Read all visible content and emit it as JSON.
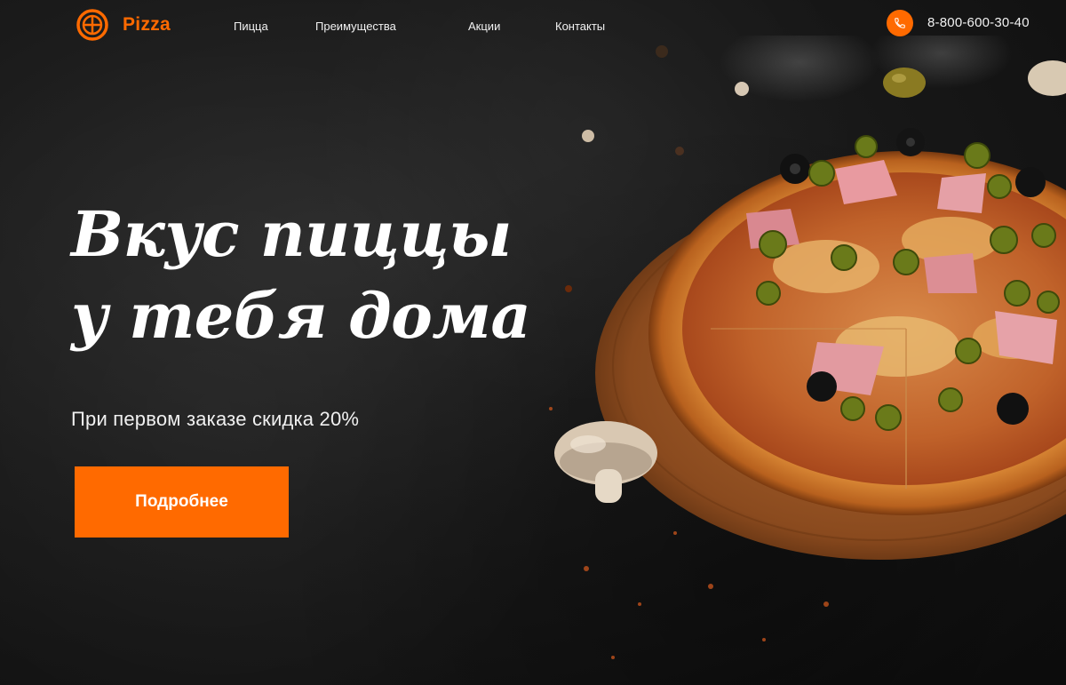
{
  "brand": {
    "name": "Pizza",
    "accent_color": "#ff6a00",
    "icon": "pizza-logo-icon"
  },
  "nav": {
    "items": [
      {
        "label": "Пицца"
      },
      {
        "label": "Преимущества"
      },
      {
        "label": "Акции"
      },
      {
        "label": "Контакты"
      }
    ]
  },
  "contact": {
    "phone_icon": "phone-icon",
    "phone": "8-800-600-30-40"
  },
  "hero": {
    "headline_line1": "Вкус пиццы",
    "headline_line2": "у тебя дома",
    "subtitle": "При первом заказе скидка 20%",
    "cta_label": "Подробнее",
    "image": "pizza-on-wooden-board"
  }
}
